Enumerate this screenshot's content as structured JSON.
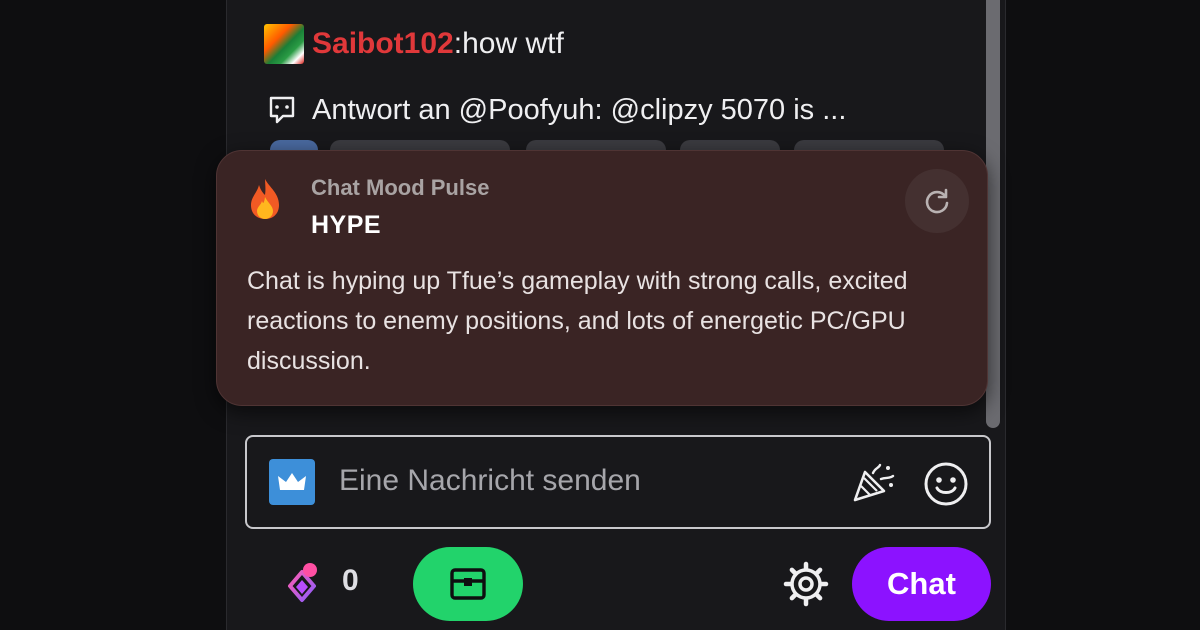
{
  "chat": {
    "message": {
      "badge_icon": "rainbow-vs-badge",
      "username": "Saibot102",
      "separator": ": ",
      "text": "how wtf",
      "username_color": "#e0383a"
    },
    "reply": {
      "icon": "reply-bubble-icon",
      "text": "Antwort an @Poofyuh: @clipzy 5070 is ..."
    }
  },
  "mood_pulse": {
    "icon": "fire-icon",
    "title": "Chat Mood Pulse",
    "label": "HYPE",
    "description": "Chat is hyping up Tfue’s gameplay with strong calls, excited reactions to enemy positions, and lots of energetic PC/GPU discussion.",
    "refresh_icon": "refresh-icon",
    "background": "#3a2424"
  },
  "input": {
    "badge_icon": "crown-icon",
    "placeholder": "Eine Nachricht senden",
    "party_icon": "party-popper-icon",
    "emoji_icon": "smiley-icon"
  },
  "footer": {
    "points_icon": "channel-points-icon",
    "points_count": "0",
    "drops_icon": "treasure-chest-icon",
    "settings_icon": "gear-icon",
    "chat_button_label": "Chat",
    "chat_button_color": "#8c12ff",
    "drops_button_color": "#22d36b"
  }
}
